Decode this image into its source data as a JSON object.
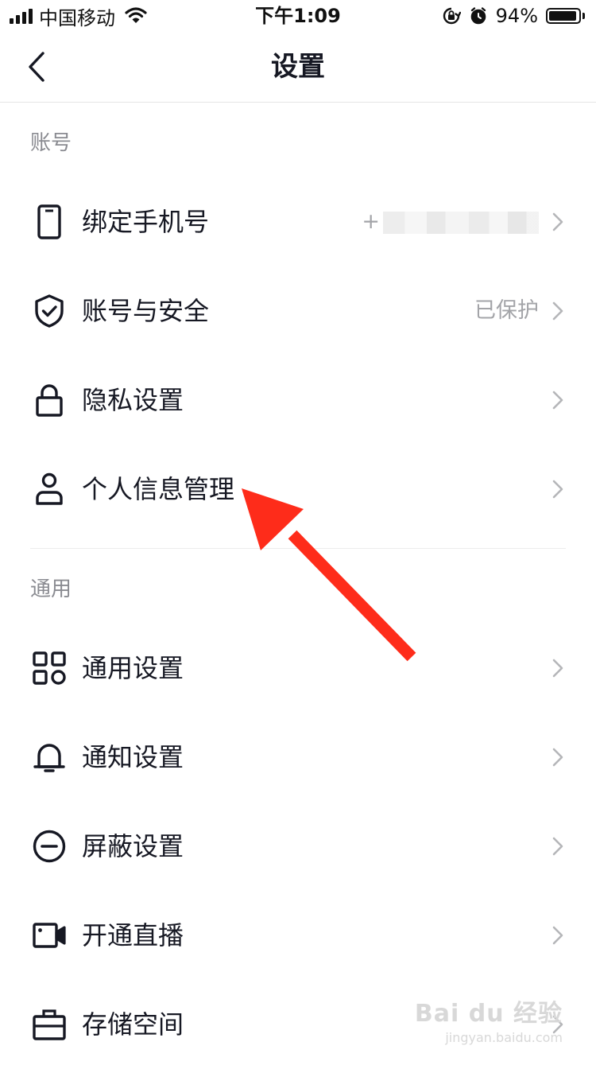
{
  "status_bar": {
    "carrier": "中国移动",
    "time": "下午1:09",
    "battery_percent": "94%",
    "battery_level": 0.94,
    "icons": [
      "signal-icon",
      "wifi-icon",
      "orientation-lock-icon",
      "alarm-icon",
      "battery-icon"
    ]
  },
  "nav": {
    "title": "设置",
    "back_icon": "chevron-left-icon"
  },
  "sections": [
    {
      "header": "账号",
      "items": [
        {
          "label": "绑定手机号",
          "value_prefix": "+",
          "value_blurred": true,
          "icon": "phone-icon"
        },
        {
          "label": "账号与安全",
          "value": "已保护",
          "icon": "shield-check-icon"
        },
        {
          "label": "隐私设置",
          "icon": "lock-icon"
        },
        {
          "label": "个人信息管理",
          "icon": "person-icon"
        }
      ]
    },
    {
      "header": "通用",
      "items": [
        {
          "label": "通用设置",
          "icon": "grid-icon"
        },
        {
          "label": "通知设置",
          "icon": "bell-icon"
        },
        {
          "label": "屏蔽设置",
          "icon": "block-icon"
        },
        {
          "label": "开通直播",
          "icon": "video-camera-icon"
        },
        {
          "label": "存储空间",
          "icon": "storage-box-icon"
        }
      ]
    }
  ],
  "annotation": {
    "arrow_color": "#fe2c1a"
  },
  "watermark": {
    "brand": "Bai du 经验",
    "url": "jingyan.baidu.com"
  },
  "colors": {
    "text": "#161823",
    "secondary": "#a3a4a8",
    "section_header": "#8a8b91",
    "divider": "#ececec"
  }
}
